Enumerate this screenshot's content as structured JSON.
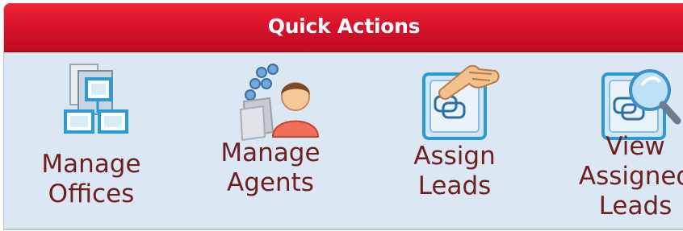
{
  "panel": {
    "title": "Quick Actions"
  },
  "actions": [
    {
      "line1": "Manage",
      "line2": "Offices",
      "icon": "offices-icon"
    },
    {
      "line1": "Manage",
      "line2": "Agents",
      "icon": "agents-icon"
    },
    {
      "line1": "Assign",
      "line2": "Leads",
      "icon": "assign-leads-icon"
    },
    {
      "line1": "View",
      "line2": "Assigned",
      "line3": "Leads",
      "icon": "view-leads-icon"
    }
  ],
  "colors": {
    "header": "#d8122a",
    "panel_bg": "#dbe8f4",
    "label_text": "#6e1f1f"
  }
}
